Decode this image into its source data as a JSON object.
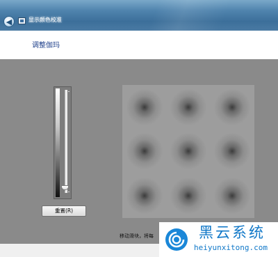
{
  "window": {
    "title": "显示颜色校准",
    "back_icon": "arrow-left-icon",
    "app_icon": "monitor-icon"
  },
  "header": {
    "title": "调整伽玛"
  },
  "gamma_slider": {
    "level": 0.03,
    "icon": "slider-thumb"
  },
  "reset_button": {
    "label": "重置(R)"
  },
  "pattern": {
    "rows": 3,
    "columns": 3
  },
  "instruction": {
    "text": "移动滑块，将每"
  },
  "watermark": {
    "title": "黑云系统",
    "url": "heiyunxitong.com",
    "color": "#1178c8"
  }
}
